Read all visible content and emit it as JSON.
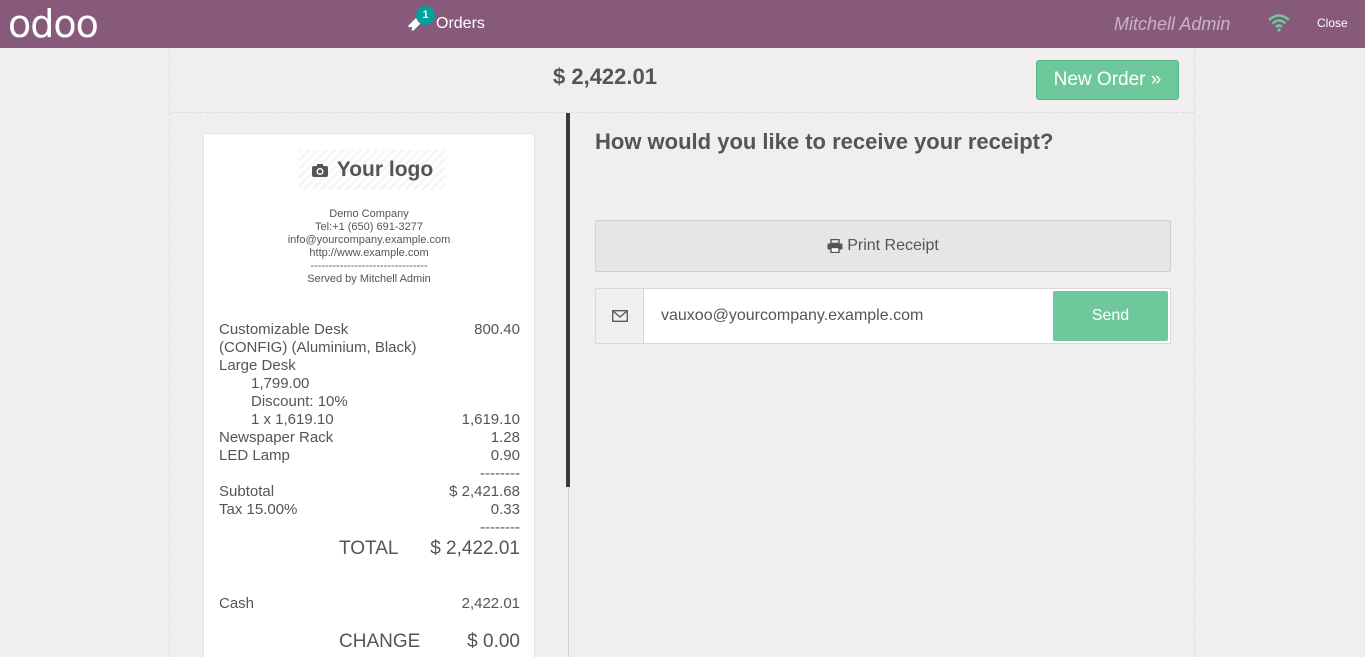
{
  "topbar": {
    "logo": "odoo",
    "orders_label": "Orders",
    "orders_count": "1",
    "user": "Mitchell Admin",
    "close_label": "Close",
    "icons": [
      "ticket-icon",
      "wifi-icon"
    ],
    "colors": {
      "bar": "#875a7b",
      "badge": "#00a09d",
      "wifi": "#6ec89b"
    }
  },
  "header": {
    "total": "$ 2,422.01",
    "new_order_label": "New Order »"
  },
  "receipt": {
    "logo_text": "Your logo",
    "company": "Demo Company",
    "tel": "Tel:+1 (650) 691-3277",
    "email": "info@yourcompany.example.com",
    "website": "http://www.example.com",
    "separator": "--------------------------------",
    "served_by": "Served by Mitchell Admin",
    "lines": [
      {
        "left": "Customizable Desk",
        "right": "800.40"
      },
      {
        "left": "(CONFIG) (Aluminium, Black)",
        "right": ""
      },
      {
        "left": "Large Desk",
        "right": ""
      },
      {
        "left": "1,799.00",
        "right": ""
      },
      {
        "left": "Discount: 10%",
        "right": ""
      },
      {
        "left": "1 x 1,619.10",
        "right": "1,619.10"
      },
      {
        "left": "Newspaper Rack",
        "right": "1.28"
      },
      {
        "left": "LED Lamp",
        "right": "0.90"
      },
      {
        "left": "",
        "right": "--------"
      },
      {
        "left": "Subtotal",
        "right": "$ 2,421.68"
      },
      {
        "left": "Tax 15.00%",
        "right": "0.33"
      },
      {
        "left": "",
        "right": "--------"
      }
    ],
    "total_label": "TOTAL",
    "total_value": "$ 2,422.01",
    "cash_label": "Cash",
    "cash_value": "2,422.01",
    "change_label": "CHANGE",
    "change_value": "$ 0.00"
  },
  "panel": {
    "question": "How would you like to receive your receipt?",
    "print_label": "Print Receipt",
    "email_value": "vauxoo@yourcompany.example.com",
    "send_label": "Send",
    "icons": [
      "print-icon",
      "envelope-icon"
    ],
    "colors": {
      "accent": "#6ec89b"
    }
  }
}
